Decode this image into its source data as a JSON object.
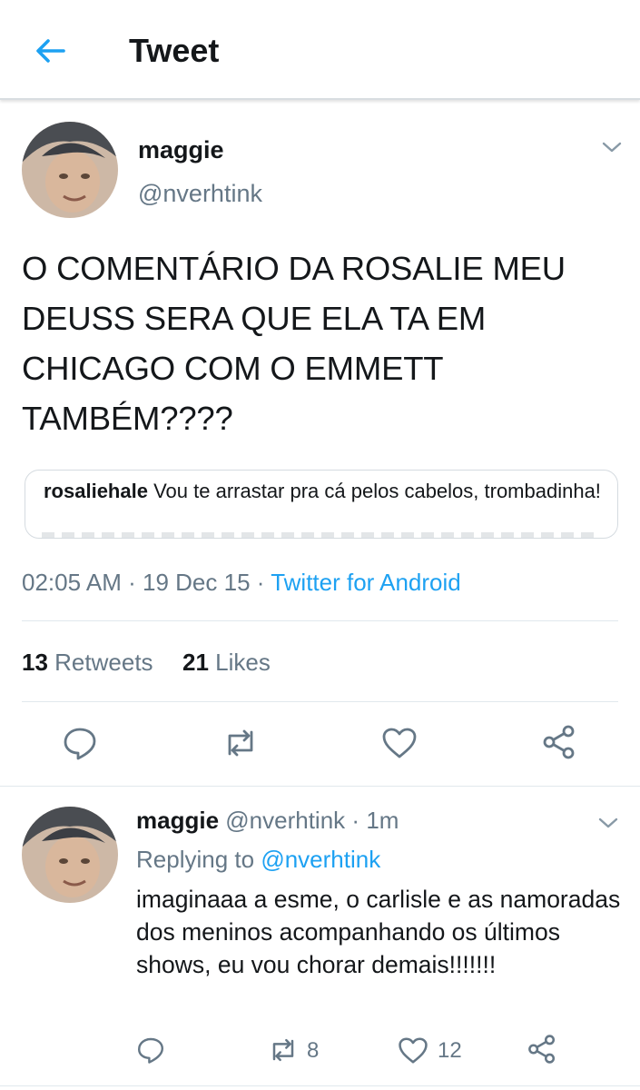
{
  "header": {
    "title": "Tweet",
    "back_icon": "back-arrow-icon"
  },
  "tweet": {
    "author_name": "maggie",
    "author_handle": "@nverhtink",
    "text": "O COMENTÁRIO DA ROSALIE MEU DEUSS SERA QUE ELA TA EM CHICAGO COM O EMMETT TAMBÉM????",
    "quote": {
      "username": "rosaliehale",
      "text": "Vou te arrastar pra cá pelos cabelos, trombadinha!"
    },
    "time": "02:05 AM",
    "date": "19 Dec 15",
    "separator": "·",
    "client": "Twitter for Android",
    "retweets_count": "13",
    "retweets_label": "Retweets",
    "likes_count": "21",
    "likes_label": "Likes"
  },
  "reply": {
    "author_name": "maggie",
    "author_handle": "@nverhtink",
    "age": "1m",
    "replying_prefix": "Replying to",
    "replying_handle": "@nverhtink",
    "text": "imaginaaa a esme, o carlisle e as namoradas dos meninos acompanhando os últimos shows, eu vou chorar demais!!!!!!!",
    "retweets": "8",
    "likes": "12"
  },
  "colors": {
    "accent": "#1da1f2",
    "secondary_text": "#657786",
    "text": "#14171a",
    "divider": "#e1e8ed"
  }
}
